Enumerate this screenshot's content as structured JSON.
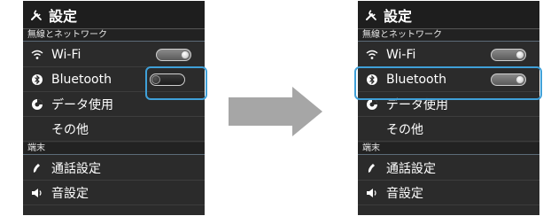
{
  "screens": [
    {
      "title": "設定",
      "section_network": "無線とネットワーク",
      "wifi_label": "Wi-Fi",
      "bluetooth_label": "Bluetooth",
      "data_usage_label": "データ使用",
      "other_label": "その他",
      "section_device": "端末",
      "call_settings_label": "通話設定",
      "sound_settings_label": "音設定",
      "wifi_state": "on",
      "bluetooth_state": "off"
    },
    {
      "title": "設定",
      "section_network": "無線とネットワーク",
      "wifi_label": "Wi-Fi",
      "bluetooth_label": "Bluetooth",
      "data_usage_label": "データ使用",
      "other_label": "その他",
      "section_device": "端末",
      "call_settings_label": "通話設定",
      "sound_settings_label": "音設定",
      "wifi_state": "on",
      "bluetooth_state": "on"
    }
  ],
  "colors": {
    "highlight": "#3fa0d8",
    "arrow": "#a6a6a6",
    "panel_background": "#2b2b2b"
  },
  "icons": [
    "settings-tools-icon",
    "wifi-icon",
    "bluetooth-icon",
    "data-usage-icon",
    "phone-handset-icon",
    "speaker-icon",
    "right-arrow-icon"
  ]
}
